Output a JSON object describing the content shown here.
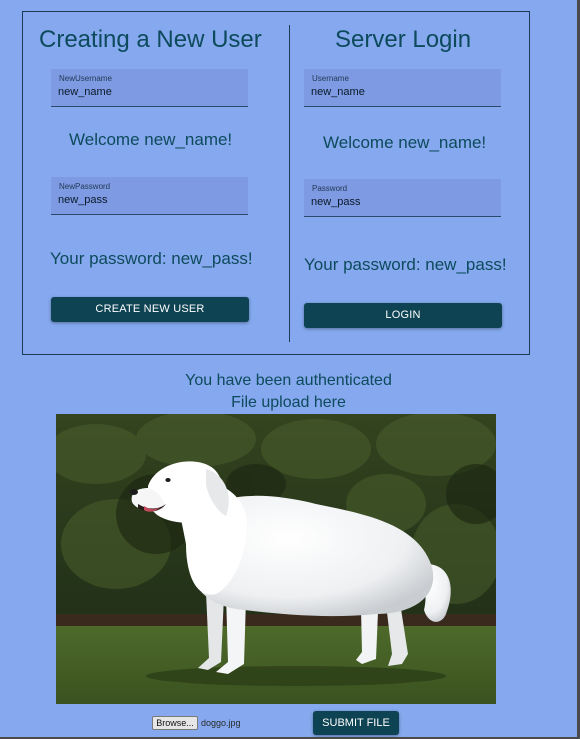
{
  "colors": {
    "background": "#85a8ee",
    "field_bg": "#7d9ae2",
    "title_text": "#0d4a5c",
    "button_bg": "#0d4352",
    "button_text": "#ffffff"
  },
  "create_user": {
    "title": "Creating a New User",
    "username_label": "NewUsername",
    "username_value": "new_name",
    "welcome": "Welcome new_name!",
    "password_label": "NewPassword",
    "password_value": "new_pass",
    "password_message": "Your password: new_pass!",
    "button_label": "CREATE NEW USER"
  },
  "login": {
    "title": "Server Login",
    "username_label": "Username",
    "username_value": "new_name",
    "welcome": "Welcome new_name!",
    "password_label": "Password",
    "password_value": "new_pass",
    "password_message": "Your password: new_pass!",
    "button_label": "LOGIN"
  },
  "upload": {
    "auth_message": "You have been authenticated",
    "upload_heading": "File upload here",
    "image_subject": "white-dog-photo",
    "browse_label": "Browse...",
    "file_name": "doggo.jpg",
    "submit_label": "SUBMIT FILE"
  }
}
